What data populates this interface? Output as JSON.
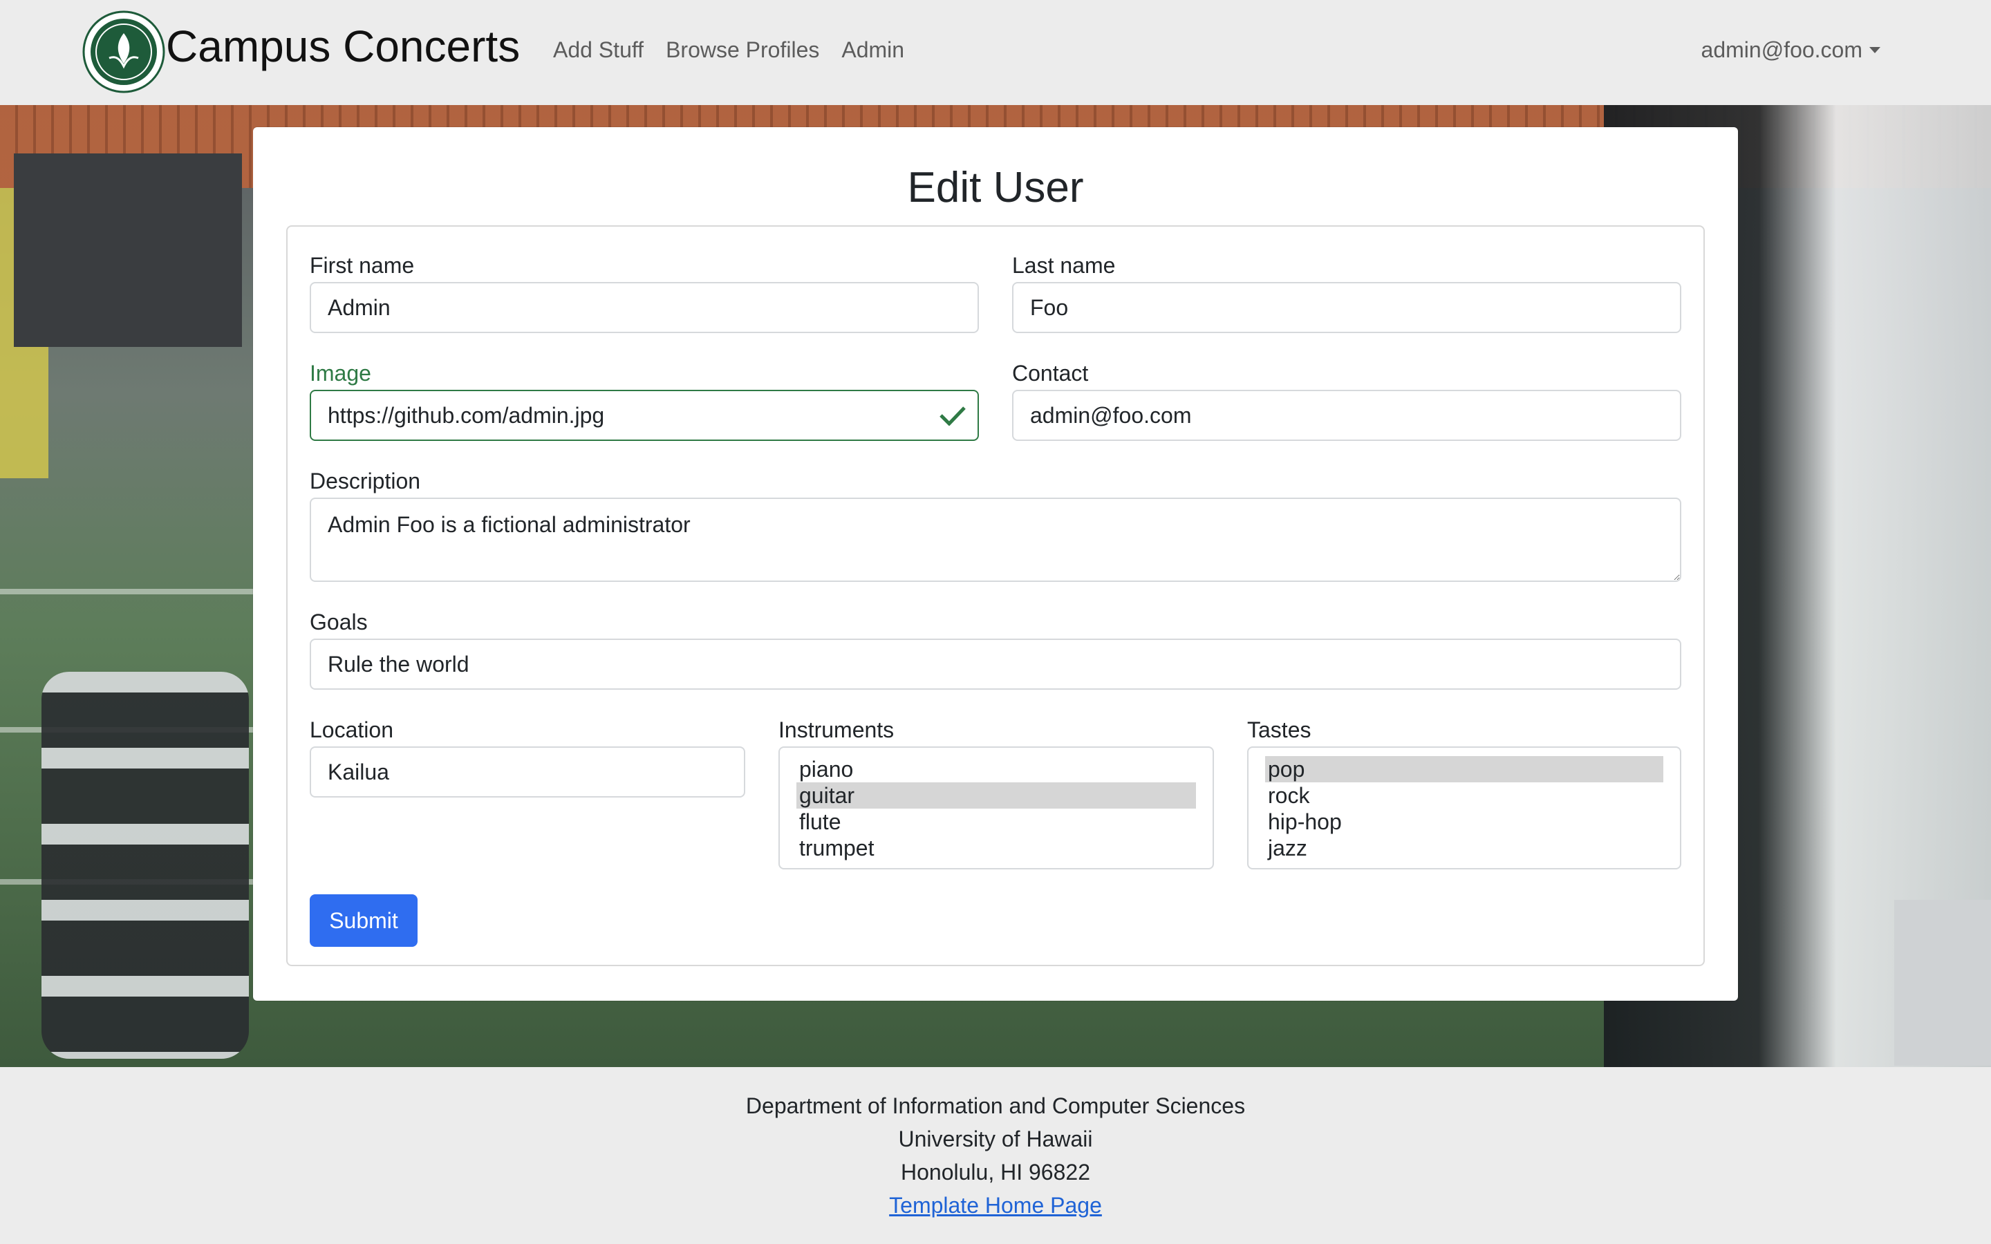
{
  "navbar": {
    "brand": "Campus Concerts",
    "links": [
      "Add Stuff",
      "Browse Profiles",
      "Admin"
    ],
    "user": "admin@foo.com"
  },
  "form": {
    "title": "Edit User",
    "first_name": {
      "label": "First name",
      "value": "Admin"
    },
    "last_name": {
      "label": "Last name",
      "value": "Foo"
    },
    "image": {
      "label": "Image",
      "value": "https://github.com/admin.jpg"
    },
    "contact": {
      "label": "Contact",
      "value": "admin@foo.com"
    },
    "description": {
      "label": "Description",
      "value": "Admin Foo is a fictional administrator"
    },
    "goals": {
      "label": "Goals",
      "value": "Rule the world"
    },
    "location": {
      "label": "Location",
      "value": "Kailua"
    },
    "instruments": {
      "label": "Instruments",
      "options": [
        "piano",
        "guitar",
        "flute",
        "trumpet"
      ],
      "selected": "guitar"
    },
    "tastes": {
      "label": "Tastes",
      "options": [
        "pop",
        "rock",
        "hip-hop",
        "jazz"
      ],
      "selected": "pop"
    },
    "submit": "Submit"
  },
  "footer": {
    "line1": "Department of Information and Computer Sciences",
    "line2": "University of Hawaii",
    "line3": "Honolulu, HI 96822",
    "link": "Template Home Page"
  },
  "colors": {
    "accent": "#2f6df0",
    "valid": "#2f7a45",
    "link": "#1f63d6"
  }
}
